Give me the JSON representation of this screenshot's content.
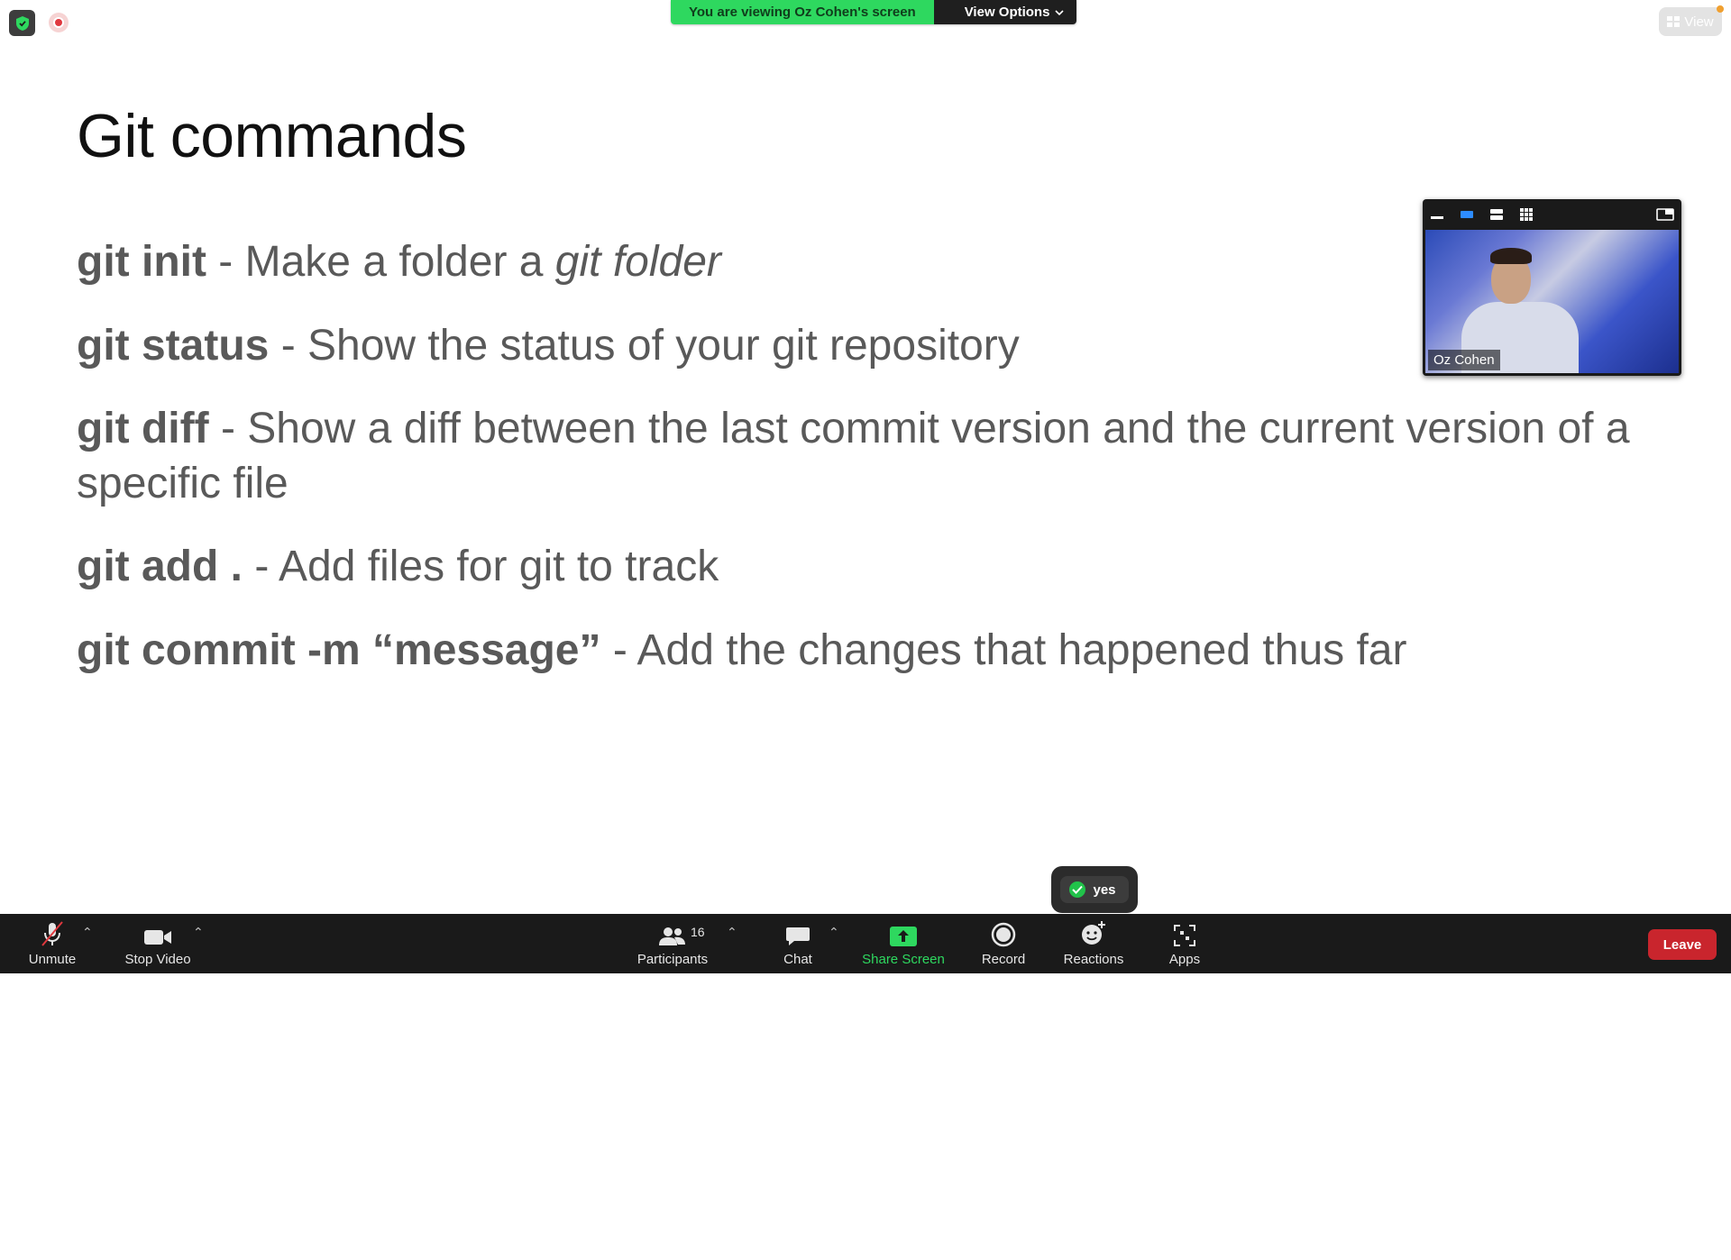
{
  "banner": {
    "viewing_text": "You are viewing Oz Cohen's screen",
    "options_label": "View Options"
  },
  "view_button": {
    "label": "View"
  },
  "slide": {
    "title": "Git commands",
    "commands": [
      {
        "cmd": "git init",
        "desc": " - Make a folder a ",
        "desc_italic": "git folder"
      },
      {
        "cmd": "git status",
        "desc": " - Show the status of your git repository"
      },
      {
        "cmd": "git diff",
        "desc": " - Show a diff between the last commit version and the current version of a specific file"
      },
      {
        "cmd": "git add .",
        "desc": " - Add files for git to track"
      },
      {
        "cmd": "git commit -m “message”",
        "desc": " - Add the changes that happened thus far"
      }
    ]
  },
  "video_thumbnail": {
    "participant_name": "Oz Cohen"
  },
  "reaction": {
    "label": "yes"
  },
  "toolbar": {
    "unmute": "Unmute",
    "stop_video": "Stop Video",
    "participants": "Participants",
    "participants_count": "16",
    "chat": "Chat",
    "share_screen": "Share Screen",
    "record": "Record",
    "reactions": "Reactions",
    "apps": "Apps",
    "leave": "Leave"
  },
  "colors": {
    "share_green": "#2ed85f",
    "leave_red": "#c9252d",
    "toolbar_bg": "#1a1a1a",
    "slide_text": "#595959"
  }
}
